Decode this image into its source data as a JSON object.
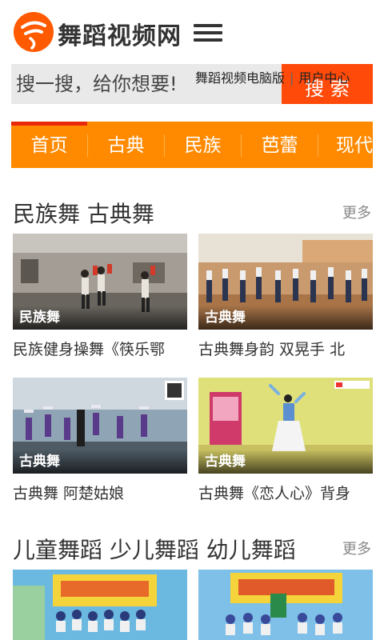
{
  "header": {
    "logo_text": "舞蹈视频网",
    "brand_color": "#ff5a00"
  },
  "search": {
    "placeholder": "搜一搜，给你想要!",
    "button_label": "搜 索",
    "link_pc": "舞蹈视频电脑版",
    "link_user": "用户中心"
  },
  "nav": {
    "items": [
      "首页",
      "古典",
      "民族",
      "芭蕾",
      "现代"
    ],
    "active_index": 0,
    "color": "#ff8a00"
  },
  "sections": [
    {
      "title": "民族舞 古典舞",
      "more": "更多",
      "cards": [
        {
          "tag": "民族舞",
          "title": "民族健身操舞《筷乐鄂"
        },
        {
          "tag": "古典舞",
          "title": "古典舞身韵 双晃手 北"
        },
        {
          "tag": "古典舞",
          "title": "古典舞 阿楚姑娘"
        },
        {
          "tag": "古典舞",
          "title": "古典舞《恋人心》背身"
        }
      ]
    },
    {
      "title": "儿童舞蹈 少儿舞蹈 幼儿舞蹈",
      "more": "更多",
      "cards": [
        {
          "tag": "",
          "title": ""
        },
        {
          "tag": "",
          "title": ""
        }
      ]
    }
  ]
}
